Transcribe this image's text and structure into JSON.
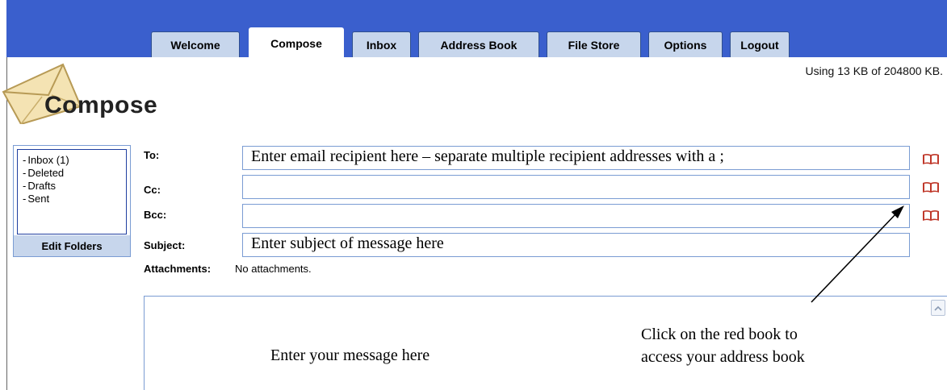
{
  "tabs": [
    {
      "label": "Welcome",
      "active": false
    },
    {
      "label": "Compose",
      "active": true
    },
    {
      "label": "Inbox",
      "active": false
    },
    {
      "label": "Address Book",
      "active": false
    },
    {
      "label": "File Store",
      "active": false
    },
    {
      "label": "Options",
      "active": false
    },
    {
      "label": "Logout",
      "active": false
    }
  ],
  "quota_text": "Using 13 KB of 204800 KB.",
  "page_title": "Compose",
  "folders": {
    "items": [
      {
        "label": "Inbox (1)"
      },
      {
        "label": "Deleted"
      },
      {
        "label": "Drafts"
      },
      {
        "label": "Sent"
      }
    ],
    "edit_button": "Edit Folders"
  },
  "compose": {
    "to_label": "To:",
    "to_value": "Enter email recipient here – separate multiple recipient addresses with a ;",
    "cc_label": "Cc:",
    "cc_value": "",
    "bcc_label": "Bcc:",
    "bcc_value": "",
    "subject_label": "Subject:",
    "subject_value": "Enter subject of message here",
    "attachments_label": "Attachments:",
    "attachments_value": "No attachments.",
    "body_text": "Enter your message here"
  },
  "annotation": {
    "line1": "Click on the red book to",
    "line2": "access your address book"
  },
  "colors": {
    "banner": "#3a5fcd",
    "tab_bg": "#c7d6ec",
    "book_red": "#c0392b"
  }
}
